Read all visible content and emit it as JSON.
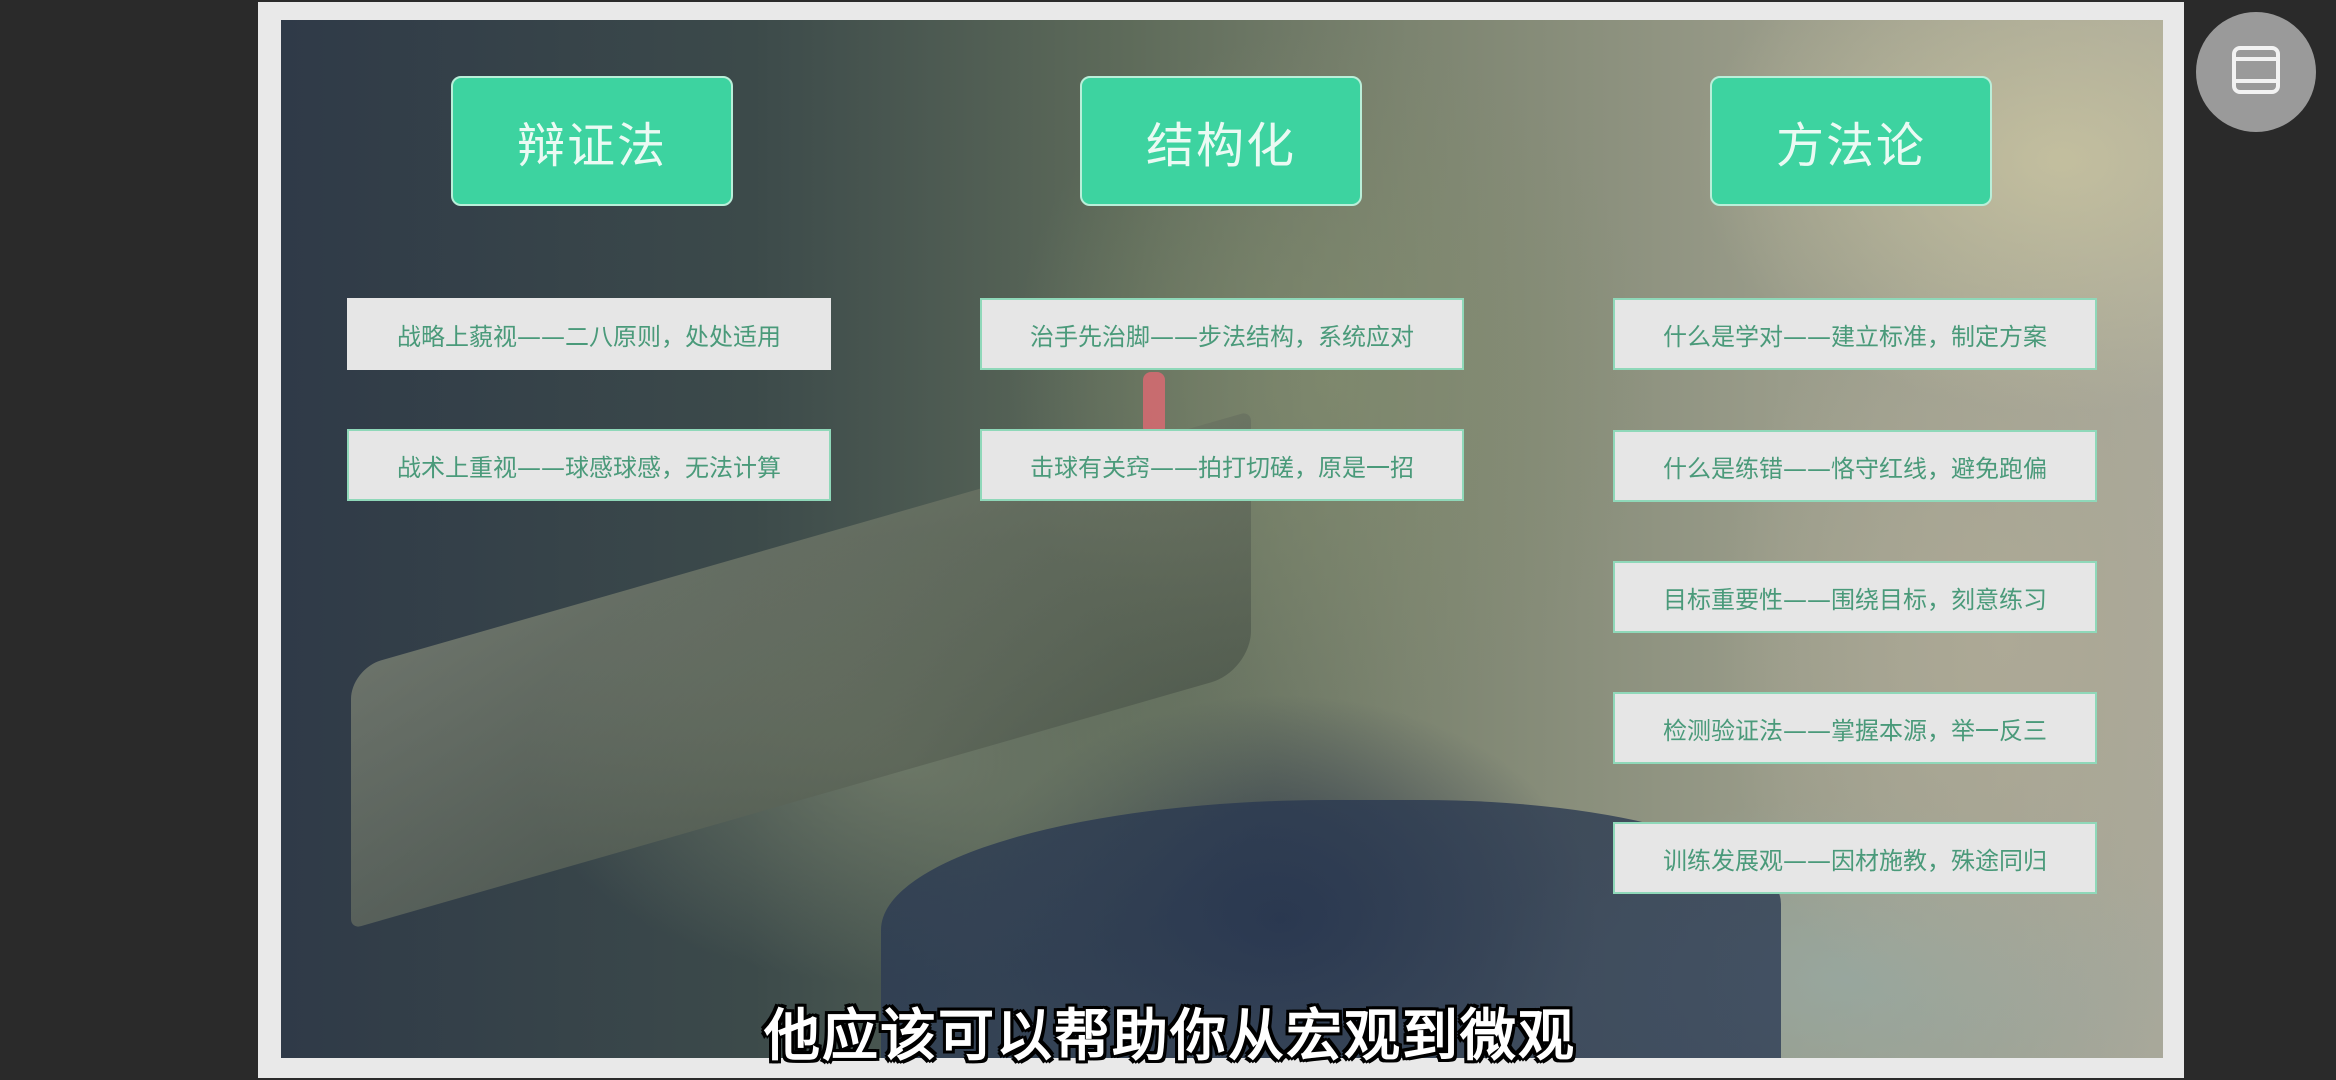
{
  "columns": [
    {
      "header": "辩证法",
      "items": [
        "战略上藐视——二八原则，处处适用",
        "战术上重视——球感球感，无法计算"
      ]
    },
    {
      "header": "结构化",
      "items": [
        "治手先治脚——步法结构，系统应对",
        "击球有关窍——拍打切磋，原是一招"
      ]
    },
    {
      "header": "方法论",
      "items": [
        "什么是学对——建立标准，制定方案",
        "什么是练错——恪守红线，避免跑偏",
        "目标重要性——围绕目标，刻意练习",
        "检测验证法——掌握本源，举一反三",
        "训练发展观——因材施教，殊途同归"
      ]
    }
  ],
  "subtitle": "他应该可以帮助你从宏观到微观",
  "floating_button": {
    "icon": "window-layout-icon"
  },
  "colors": {
    "header_bg": "#3dd3a0",
    "item_text": "#4a9a7a",
    "item_bg": "#e6e6e6"
  }
}
